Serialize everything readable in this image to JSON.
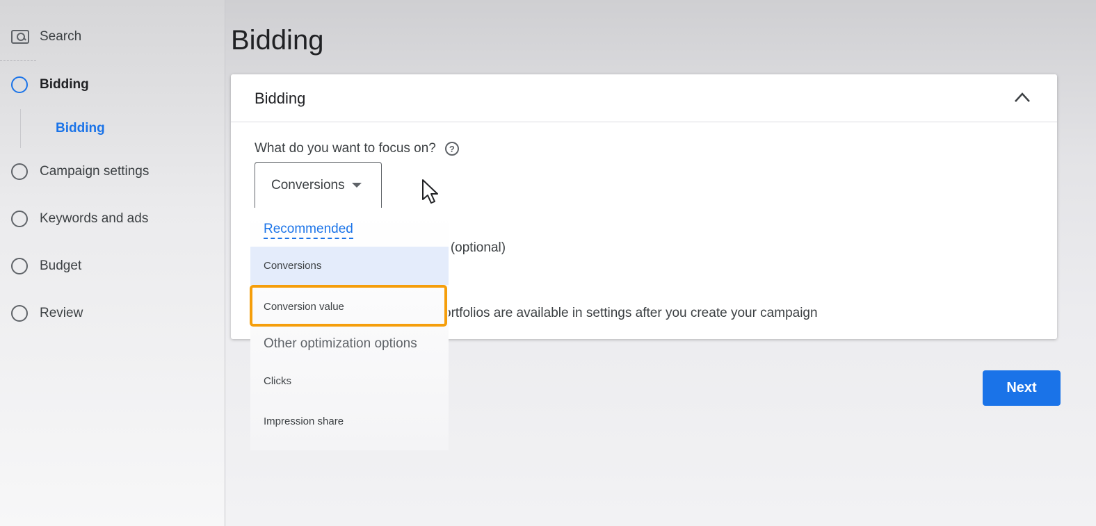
{
  "sidebar": {
    "search_label": "Search",
    "items": [
      {
        "label": "Bidding",
        "state": "active"
      },
      {
        "label": "Campaign settings",
        "state": "pending"
      },
      {
        "label": "Keywords and ads",
        "state": "pending"
      },
      {
        "label": "Budget",
        "state": "pending"
      },
      {
        "label": "Review",
        "state": "pending"
      }
    ],
    "sub_item": "Bidding"
  },
  "page_title": "Bidding",
  "card": {
    "title": "Bidding",
    "question": "What do you want to focus on?",
    "selected_value": "Conversions",
    "partial_text_1": "n (optional)",
    "partial_text_2": "ortfolios are available in settings after you create your campaign"
  },
  "dropdown": {
    "recommended_label": "Recommended",
    "options": [
      "Conversions",
      "Conversion value"
    ],
    "other_section_label": "Other optimization options",
    "other_options": [
      "Clicks",
      "Impression share"
    ],
    "highlighted_option": "Conversion value"
  },
  "next_button": "Next",
  "colors": {
    "accent": "#1a73e8",
    "highlight_border": "#f59e0b",
    "selected_bg": "#e4ecfb"
  },
  "icons": {
    "search": "search-icon",
    "collapse": "chevron-up-icon",
    "help": "help-icon",
    "caret": "caret-down-icon",
    "cursor": "mouse-pointer-icon"
  }
}
